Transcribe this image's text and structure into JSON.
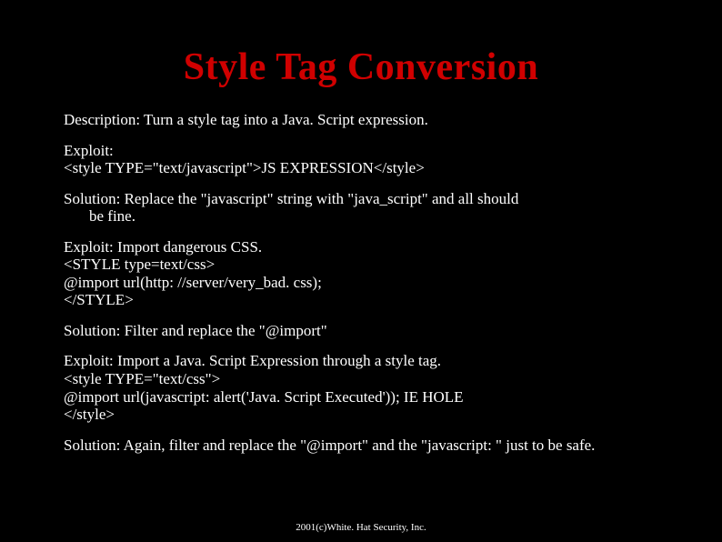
{
  "title": "Style Tag Conversion",
  "p1": "Description: Turn a style tag into a Java. Script expression.",
  "p2a": "Exploit:",
  "p2b": "<style TYPE=\"text/javascript\">JS EXPRESSION</style>",
  "p3a": "Solution: Replace the \"javascript\" string with \"java_script\" and all should",
  "p3b": "be fine.",
  "p4a": "Exploit:  Import dangerous CSS.",
  "p4b": "<STYLE type=text/css>",
  "p4c": "@import url(http: //server/very_bad. css);",
  "p4d": "</STYLE>",
  "p5": "Solution: Filter and replace the \"@import\"",
  "p6a": "Exploit: Import a Java. Script Expression through a style tag.",
  "p6b": "<style TYPE=\"text/css\">",
  "p6c": "@import url(javascript: alert('Java. Script Executed'));   IE HOLE",
  "p6d": "</style>",
  "p7": "Solution: Again, filter and replace the \"@import\" and the \"javascript: \" just to be safe.",
  "footer": "2001(c)White. Hat Security, Inc."
}
